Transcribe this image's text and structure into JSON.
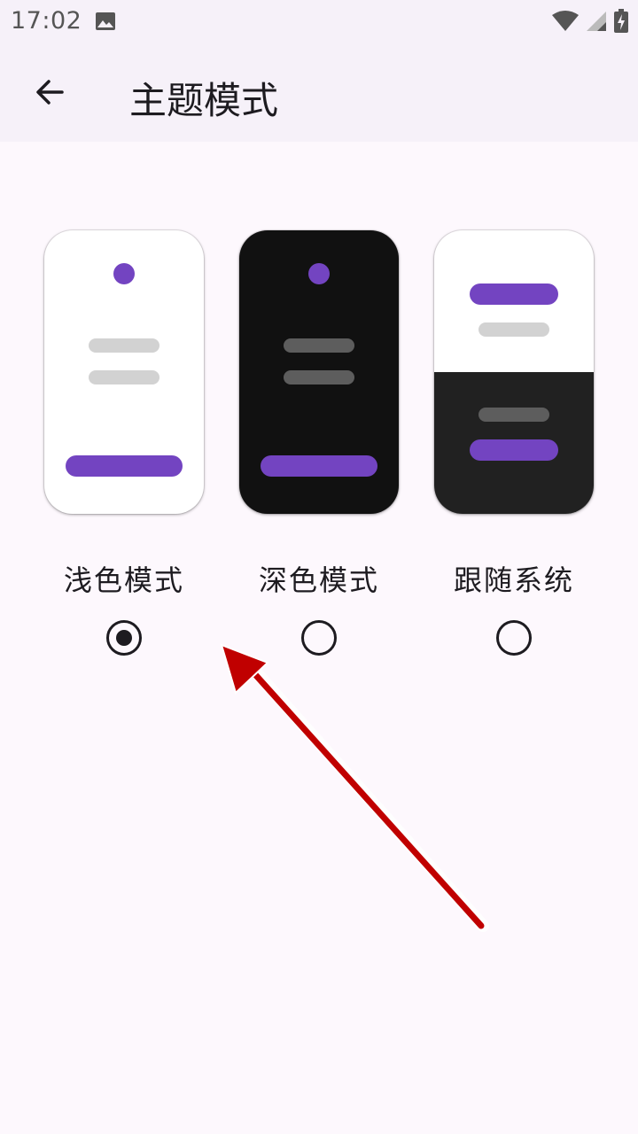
{
  "status_bar": {
    "time": "17:02",
    "icons": [
      "image-icon",
      "wifi-icon",
      "cellular-signal-icon",
      "battery-charging-icon"
    ]
  },
  "app_bar": {
    "back_icon": "arrow-back-icon",
    "title": "主题模式"
  },
  "theme_options": [
    {
      "label": "浅色模式",
      "selected": true
    },
    {
      "label": "深色模式",
      "selected": false
    },
    {
      "label": "跟随系统",
      "selected": false
    }
  ],
  "colors": {
    "accent": "#7344c1",
    "background": "#fdf8fd",
    "app_bar": "#f6f1f9",
    "annotation_arrow": "#c00000"
  }
}
